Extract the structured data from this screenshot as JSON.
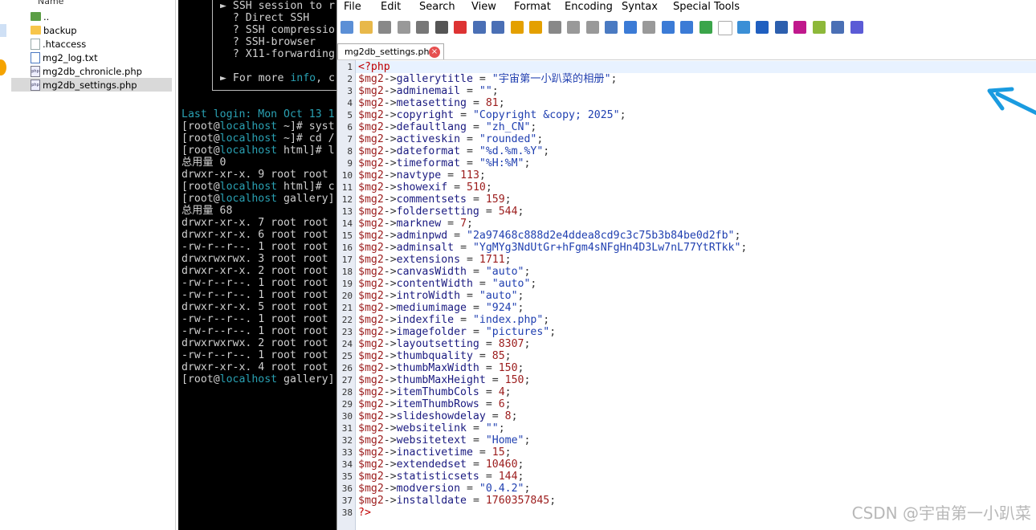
{
  "left_panel": {
    "header": "Name",
    "files": [
      {
        "name": "..",
        "type": "folderup"
      },
      {
        "name": "backup",
        "type": "folder"
      },
      {
        "name": ".htaccess",
        "type": "file"
      },
      {
        "name": "mg2_log.txt",
        "type": "txt"
      },
      {
        "name": "mg2db_chronicle.php",
        "type": "php"
      },
      {
        "name": "mg2db_settings.php",
        "type": "php",
        "selected": true
      }
    ]
  },
  "terminal": {
    "box_lines": [
      "► SSH session to r",
      "  ? Direct SSH",
      "  ? SSH compressio",
      "  ? SSH-browser",
      "  ? X11-forwarding",
      "",
      "► For more info, c"
    ],
    "lines": [
      {
        "pre": "Last login: Mon Oct 13 1",
        "host": "",
        "post": "",
        "cyan": true
      },
      {
        "pre": "[root@",
        "host": "localhost",
        "post": " ~]# syst"
      },
      {
        "pre": "[root@",
        "host": "localhost",
        "post": " ~]# cd /"
      },
      {
        "pre": "[root@",
        "host": "localhost",
        "post": " html]# l"
      },
      {
        "pre": "总用量 0",
        "host": "",
        "post": ""
      },
      {
        "pre": "drwxr-xr-x. 9 root root",
        "host": "",
        "post": ""
      },
      {
        "pre": "[root@",
        "host": "localhost",
        "post": " html]# c"
      },
      {
        "pre": "[root@",
        "host": "localhost",
        "post": " gallery]"
      },
      {
        "pre": "总用量 68",
        "host": "",
        "post": ""
      },
      {
        "pre": "drwxr-xr-x. 7 root root",
        "host": "",
        "post": ""
      },
      {
        "pre": "drwxr-xr-x. 6 root root",
        "host": "",
        "post": ""
      },
      {
        "pre": "-rw-r--r--. 1 root root",
        "host": "",
        "post": ""
      },
      {
        "pre": "drwxrwxrwx. 3 root root",
        "host": "",
        "post": ""
      },
      {
        "pre": "drwxr-xr-x. 2 root root",
        "host": "",
        "post": ""
      },
      {
        "pre": "-rw-r--r--. 1 root root",
        "host": "",
        "post": ""
      },
      {
        "pre": "-rw-r--r--. 1 root root",
        "host": "",
        "post": ""
      },
      {
        "pre": "drwxr-xr-x. 5 root root",
        "host": "",
        "post": ""
      },
      {
        "pre": "-rw-r--r--. 1 root root",
        "host": "",
        "post": ""
      },
      {
        "pre": "-rw-r--r--. 1 root root",
        "host": "",
        "post": ""
      },
      {
        "pre": "drwxrwxrwx. 2 root root",
        "host": "",
        "post": ""
      },
      {
        "pre": "-rw-r--r--. 1 root root",
        "host": "",
        "post": ""
      },
      {
        "pre": "drwxr-xr-x. 4 root root",
        "host": "",
        "post": ""
      },
      {
        "pre": "[root@",
        "host": "localhost",
        "post": " gallery]"
      }
    ]
  },
  "editor": {
    "menu": [
      "File",
      "Edit",
      "Search",
      "View",
      "Format",
      "Encoding",
      "Syntax",
      "Special Tools"
    ],
    "tab": "mg2db_settings.php",
    "code": [
      {
        "t": "tag",
        "v": "<?php"
      },
      {
        "p": "gallerytitle",
        "v": "\"宇宙第一小趴菜的相册\"",
        "k": "str"
      },
      {
        "p": "adminemail",
        "v": "\"\"",
        "k": "str"
      },
      {
        "p": "metasetting",
        "v": "81",
        "k": "num"
      },
      {
        "p": "copyright",
        "v": "\"Copyright &copy; 2025\"",
        "k": "str"
      },
      {
        "p": "defaultlang",
        "v": "\"zh_CN\"",
        "k": "str"
      },
      {
        "p": "activeskin",
        "v": "\"rounded\"",
        "k": "str"
      },
      {
        "p": "dateformat",
        "v": "\"%d.%m.%Y\"",
        "k": "str"
      },
      {
        "p": "timeformat",
        "v": "\"%H:%M\"",
        "k": "str"
      },
      {
        "p": "navtype",
        "v": "113",
        "k": "num"
      },
      {
        "p": "showexif",
        "v": "510",
        "k": "num"
      },
      {
        "p": "commentsets",
        "v": "159",
        "k": "num"
      },
      {
        "p": "foldersetting",
        "v": "544",
        "k": "num"
      },
      {
        "p": "marknew",
        "v": "7",
        "k": "num"
      },
      {
        "p": "adminpwd",
        "v": "\"2a97468c888d2e4ddea8cd9c3c75b3b84be0d2fb\"",
        "k": "str"
      },
      {
        "p": "adminsalt",
        "v": "\"YgMYg3NdUtGr+hFgm4sNFgHn4D3Lw7nL77YtRTkk\"",
        "k": "str"
      },
      {
        "p": "extensions",
        "v": "1711",
        "k": "num"
      },
      {
        "p": "canvasWidth",
        "v": "\"auto\"",
        "k": "str"
      },
      {
        "p": "contentWidth",
        "v": "\"auto\"",
        "k": "str"
      },
      {
        "p": "introWidth",
        "v": "\"auto\"",
        "k": "str"
      },
      {
        "p": "mediumimage",
        "v": "\"924\"",
        "k": "str"
      },
      {
        "p": "indexfile",
        "v": "\"index.php\"",
        "k": "str"
      },
      {
        "p": "imagefolder",
        "v": "\"pictures\"",
        "k": "str"
      },
      {
        "p": "layoutsetting",
        "v": "8307",
        "k": "num"
      },
      {
        "p": "thumbquality",
        "v": "85",
        "k": "num"
      },
      {
        "p": "thumbMaxWidth",
        "v": "150",
        "k": "num"
      },
      {
        "p": "thumbMaxHeight",
        "v": "150",
        "k": "num"
      },
      {
        "p": "itemThumbCols",
        "v": "4",
        "k": "num"
      },
      {
        "p": "itemThumbRows",
        "v": "6",
        "k": "num"
      },
      {
        "p": "slideshowdelay",
        "v": "8",
        "k": "num"
      },
      {
        "p": "websitelink",
        "v": "\"\"",
        "k": "str"
      },
      {
        "p": "websitetext",
        "v": "\"Home\"",
        "k": "str"
      },
      {
        "p": "inactivetime",
        "v": "15",
        "k": "num"
      },
      {
        "p": "extendedset",
        "v": "10460",
        "k": "num"
      },
      {
        "p": "statisticsets",
        "v": "144",
        "k": "num"
      },
      {
        "p": "modversion",
        "v": "\"0.4.2\"",
        "k": "str"
      },
      {
        "p": "installdate",
        "v": "1760357845",
        "k": "num"
      },
      {
        "t": "tag",
        "v": "?>"
      }
    ]
  },
  "watermark": "CSDN @宇宙第一小趴菜",
  "colors": {
    "arrow": "#1a9be0",
    "var": "#9b1b1b",
    "string": "#1f3fb0"
  }
}
